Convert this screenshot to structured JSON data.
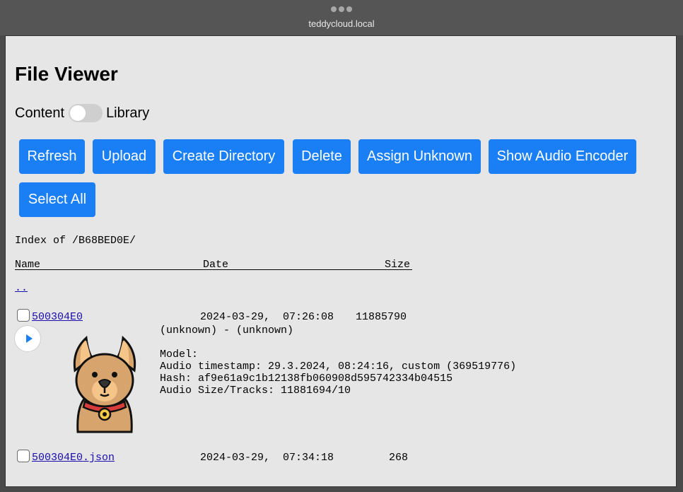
{
  "browser": {
    "url": "teddycloud.local"
  },
  "page": {
    "title": "File Viewer",
    "toggle": {
      "left_label": "Content",
      "right_label": "Library"
    },
    "buttons": {
      "refresh": "Refresh",
      "upload": "Upload",
      "create_directory": "Create Directory",
      "delete": "Delete",
      "assign_unknown": "Assign Unknown",
      "show_audio_encoder": "Show Audio Encoder",
      "select_all": "Select All"
    },
    "index_label": "Index of /B68BED0E/",
    "columns": {
      "name": "Name",
      "date": "Date",
      "size": "Size"
    },
    "parent_link": "..",
    "files": [
      {
        "name": "500304E0",
        "date": "2024-03-29,  07:26:08",
        "size": "11885790",
        "artist_title": "(unknown) - (unknown)",
        "model": "Model:",
        "audio_timestamp": "Audio timestamp: 29.3.2024, 08:24:16, custom (369519776)",
        "hash": "Hash: af9e61a9c1b12138fb060908d595742334b04515",
        "audio_size_tracks": "Audio Size/Tracks: 11881694/10"
      },
      {
        "name": "500304E0.json",
        "date": "2024-03-29,  07:34:18",
        "size": "268"
      }
    ]
  },
  "colors": {
    "accent": "#1a7ff5",
    "link": "#1a0dab",
    "background": "#e6e6e6"
  }
}
